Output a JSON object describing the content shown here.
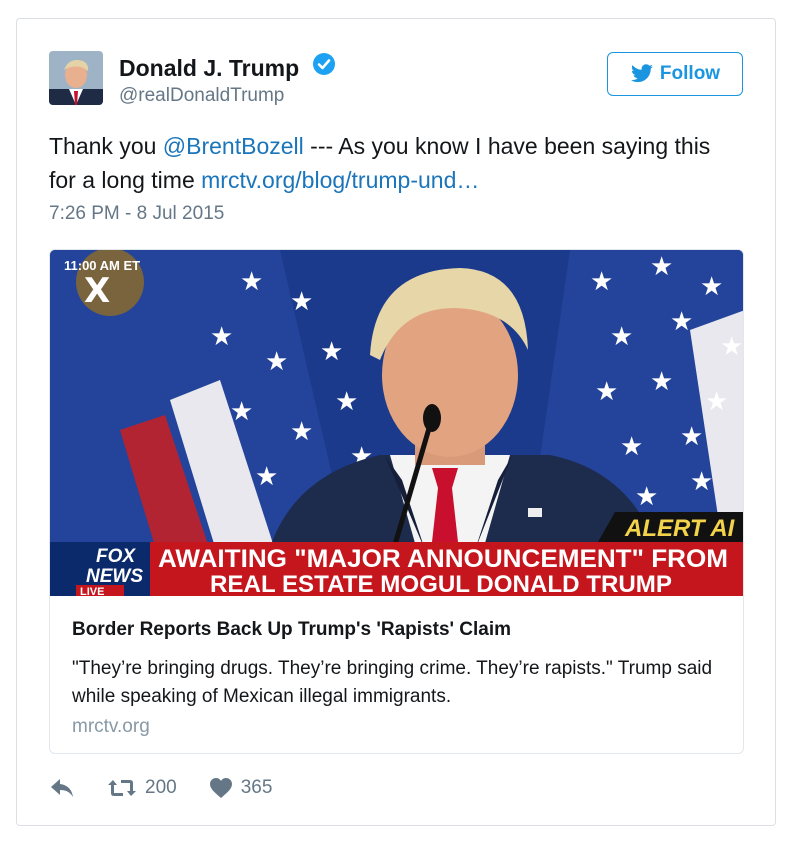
{
  "user": {
    "name": "Donald J. Trump",
    "handle": "@realDonaldTrump"
  },
  "follow_label": "Follow",
  "tweet": {
    "text_prefix": "Thank you ",
    "mention": "@BrentBozell",
    "text_middle": " --- As you know I have been saying this for a long time ",
    "link": "mrctv.org/blog/trump-und…",
    "timestamp": "7:26 PM - 8 Jul 2015"
  },
  "card": {
    "image_overlay": {
      "corner_bug": "11:00 AM ET",
      "network_logo_line1": "FOX",
      "network_logo_line2": "NEWS",
      "live_label": "LIVE",
      "alert_label": "ALERT AI",
      "headline_line1": "AWAITING \"MAJOR ANNOUNCEMENT\" FROM",
      "headline_line2": "REAL ESTATE MOGUL DONALD TRUMP"
    },
    "title": "Border Reports Back Up Trump's 'Rapists' Claim",
    "description": "\"They’re bringing drugs. They’re bringing crime. They’re rapists.\" Trump said while speaking of Mexican illegal immigrants.",
    "domain": "mrctv.org"
  },
  "stats": {
    "retweets": "200",
    "likes": "365"
  },
  "colors": {
    "accent": "#1b95e0",
    "link": "#1b75bb",
    "muted": "#657786",
    "tie_red": "#c8102e",
    "banner_red": "#c4161c"
  }
}
